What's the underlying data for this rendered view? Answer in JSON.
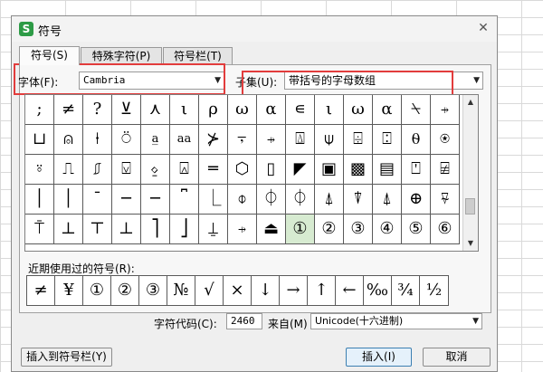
{
  "window": {
    "title": "符号",
    "app_icon_letter": "S",
    "close_glyph": "✕"
  },
  "tabs": [
    {
      "label": "符号(S)",
      "active": true
    },
    {
      "label": "特殊字符(P)",
      "active": false
    },
    {
      "label": "符号栏(T)",
      "active": false
    }
  ],
  "font": {
    "label": "字体(F):",
    "value": "Cambria"
  },
  "subset": {
    "label": "子集(U):",
    "value": "带括号的字母数组"
  },
  "symbols": [
    [
      ";",
      "≠",
      "?",
      "⊻",
      "⋏",
      "ι",
      "ρ",
      "ω",
      "α",
      "∊",
      "ι",
      "ω",
      "α",
      "⍀",
      "⍆"
    ],
    [
      "⊔",
      "⍝",
      "⍿",
      "⍥",
      "a̲",
      "aa",
      "⊁",
      "⍪",
      "⍆",
      "⍍",
      "⍦",
      "⌹",
      "⍠",
      "⍬",
      "⍟"
    ],
    [
      "⍤",
      "⎍",
      "⎎",
      "⍌",
      "⍚",
      "⍓",
      "═",
      "⬡",
      "▯",
      "◤",
      "▣",
      "▩",
      "▤",
      "⍞",
      "⍯"
    ],
    [
      "│",
      "│",
      "¯",
      "─",
      "─",
      "⎴",
      "⎿",
      "⌽",
      "⏀",
      "⏀",
      "⍋",
      "⍒",
      "⍋",
      "⊕",
      "⍫"
    ],
    [
      "⍑",
      "⊥",
      "⊤",
      "⊥",
      "⎤",
      "⎦",
      "⍊",
      "⍆",
      "⏏",
      "①",
      "②",
      "③",
      "④",
      "⑤",
      "⑥"
    ]
  ],
  "selected_symbol": "①",
  "recent": {
    "label": "近期使用过的符号(R):",
    "symbols": [
      "≠",
      "¥",
      "①",
      "②",
      "③",
      "№",
      "√",
      "×",
      "↓",
      "→",
      "↑",
      "←",
      "‰",
      "¾",
      "½"
    ]
  },
  "char_code": {
    "label": "字符代码(C):",
    "value": "2460"
  },
  "from": {
    "label": "来自(M)",
    "value": "Unicode(十六进制)"
  },
  "buttons": {
    "insert_to_bar": "插入到符号栏(Y)",
    "insert": "插入(I)",
    "cancel": "取消"
  },
  "colors": {
    "highlight_box": "#e23c3c",
    "selected_cell": "#d7ebd1",
    "app_icon": "#2d9b46"
  }
}
